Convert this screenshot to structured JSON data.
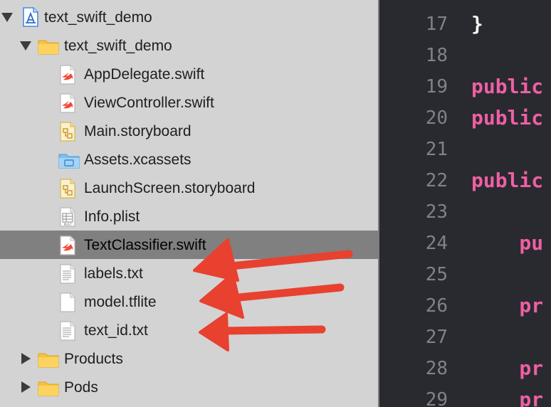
{
  "navigator": {
    "project": {
      "label": "text_swift_demo"
    },
    "group": {
      "label": "text_swift_demo"
    },
    "files": [
      {
        "label": "AppDelegate.swift",
        "icon": "swift-file-icon"
      },
      {
        "label": "ViewController.swift",
        "icon": "swift-file-icon"
      },
      {
        "label": "Main.storyboard",
        "icon": "storyboard-file-icon"
      },
      {
        "label": "Assets.xcassets",
        "icon": "asset-catalog-icon"
      },
      {
        "label": "LaunchScreen.storyboard",
        "icon": "storyboard-file-icon"
      },
      {
        "label": "Info.plist",
        "icon": "plist-file-icon"
      },
      {
        "label": "TextClassifier.swift",
        "icon": "swift-file-icon",
        "selected": true
      },
      {
        "label": "labels.txt",
        "icon": "text-file-icon"
      },
      {
        "label": "model.tflite",
        "icon": "blank-file-icon"
      },
      {
        "label": "text_id.txt",
        "icon": "text-file-icon"
      }
    ],
    "folders": [
      {
        "label": "Products",
        "icon": "folder-icon"
      },
      {
        "label": "Pods",
        "icon": "folder-icon"
      }
    ]
  },
  "editor": {
    "lines": [
      {
        "num": "17",
        "code": "}",
        "cls": "plain"
      },
      {
        "num": "18",
        "code": "",
        "cls": "plain"
      },
      {
        "num": "19",
        "code": "public",
        "cls": "kw"
      },
      {
        "num": "20",
        "code": "public",
        "cls": "kw"
      },
      {
        "num": "21",
        "code": "",
        "cls": "plain"
      },
      {
        "num": "22",
        "code": "public",
        "cls": "kw"
      },
      {
        "num": "23",
        "code": "",
        "cls": "plain"
      },
      {
        "num": "24",
        "code": "    pu",
        "cls": "kw"
      },
      {
        "num": "25",
        "code": "",
        "cls": "plain"
      },
      {
        "num": "26",
        "code": "    pr",
        "cls": "kw"
      },
      {
        "num": "27",
        "code": "",
        "cls": "plain"
      },
      {
        "num": "28",
        "code": "    pr",
        "cls": "kw"
      },
      {
        "num": "29",
        "code": "    pr",
        "cls": "kw"
      }
    ]
  },
  "colors": {
    "keyword": "#ef5fa3",
    "annotation_arrow": "#e8412f",
    "selection": "#808080",
    "editor_background": "#292a30"
  }
}
